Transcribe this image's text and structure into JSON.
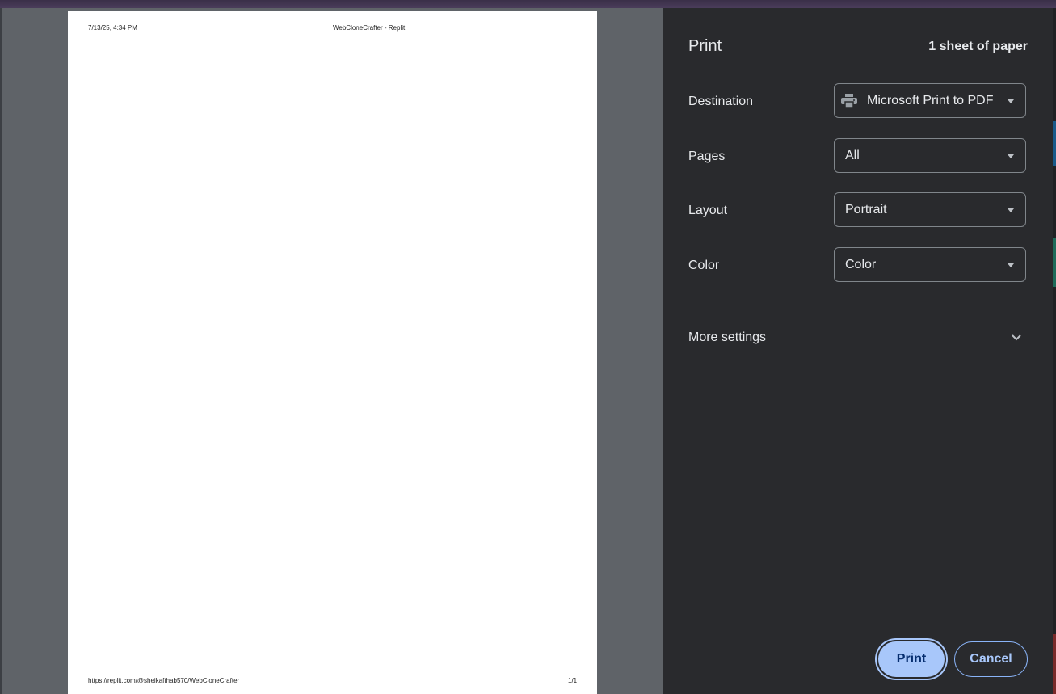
{
  "preview": {
    "header_date": "7/13/25, 4:34 PM",
    "header_title": "WebCloneCrafter - Replit",
    "footer_url": "https://replit.com/@sheikafthab570/WebCloneCrafter",
    "footer_page": "1/1"
  },
  "panel": {
    "title": "Print",
    "sheet_count": "1 sheet of paper",
    "destination": {
      "label": "Destination",
      "value": "Microsoft Print to PDF",
      "icon": "printer-icon"
    },
    "pages": {
      "label": "Pages",
      "value": "All"
    },
    "layout": {
      "label": "Layout",
      "value": "Portrait"
    },
    "color": {
      "label": "Color",
      "value": "Color"
    },
    "more_settings": "More settings",
    "print_button": "Print",
    "cancel_button": "Cancel"
  },
  "colors": {
    "panel_bg": "#292a2d",
    "preview_bg": "#5f6368",
    "accent": "#a8c7fa"
  }
}
